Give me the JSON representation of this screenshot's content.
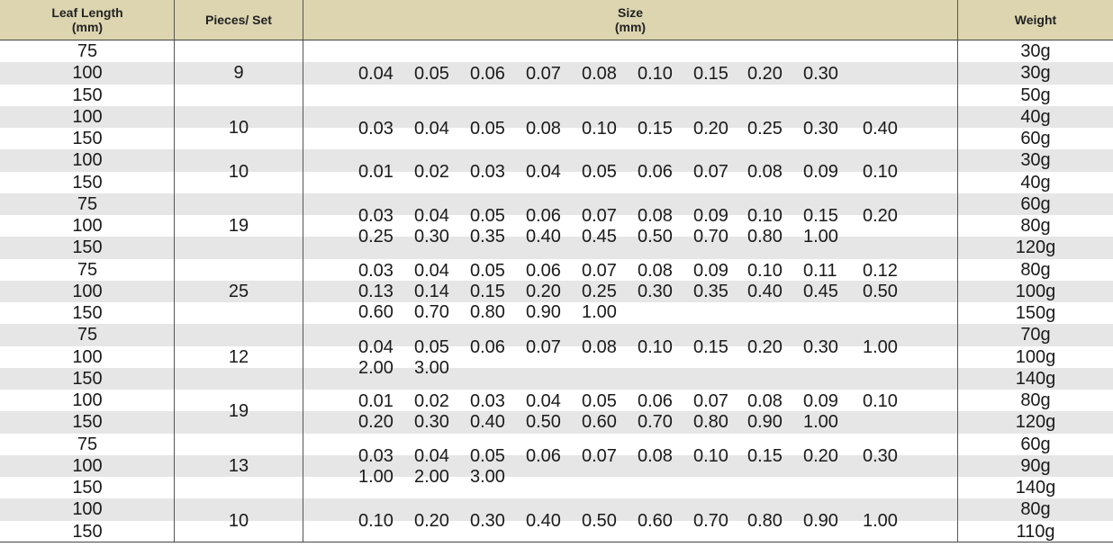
{
  "headers": {
    "leaf_length": [
      "Leaf Length",
      "(mm)"
    ],
    "pieces": "Pieces/ Set",
    "size": [
      "Size",
      "(mm)"
    ],
    "weight": "Weight"
  },
  "groups": [
    {
      "lengths": [
        "75",
        "100",
        "150"
      ],
      "pieces": "9",
      "sizes": [
        [
          "0.04",
          "0.05",
          "0.06",
          "0.07",
          "0.08",
          "0.10",
          "0.15",
          "0.20",
          "0.30"
        ]
      ],
      "weights": [
        "30g",
        "30g",
        "50g"
      ]
    },
    {
      "lengths": [
        "100",
        "150"
      ],
      "pieces": "10",
      "sizes": [
        [
          "0.03",
          "0.04",
          "0.05",
          "0.08",
          "0.10",
          "0.15",
          "0.20",
          "0.25",
          "0.30",
          "0.40"
        ]
      ],
      "weights": [
        "40g",
        "60g"
      ]
    },
    {
      "lengths": [
        "100",
        "150"
      ],
      "pieces": "10",
      "sizes": [
        [
          "0.01",
          "0.02",
          "0.03",
          "0.04",
          "0.05",
          "0.06",
          "0.07",
          "0.08",
          "0.09",
          "0.10"
        ]
      ],
      "weights": [
        "30g",
        "40g"
      ]
    },
    {
      "lengths": [
        "75",
        "100",
        "150"
      ],
      "pieces": "19",
      "sizes": [
        [
          "0.03",
          "0.04",
          "0.05",
          "0.06",
          "0.07",
          "0.08",
          "0.09",
          "0.10",
          "0.15",
          "0.20"
        ],
        [
          "0.25",
          "0.30",
          "0.35",
          "0.40",
          "0.45",
          "0.50",
          "0.70",
          "0.80",
          "1.00"
        ]
      ],
      "weights": [
        "60g",
        "80g",
        "120g"
      ]
    },
    {
      "lengths": [
        "75",
        "100",
        "150"
      ],
      "pieces": "25",
      "sizes": [
        [
          "0.03",
          "0.04",
          "0.05",
          "0.06",
          "0.07",
          "0.08",
          "0.09",
          "0.10",
          "0.11",
          "0.12"
        ],
        [
          "0.13",
          "0.14",
          "0.15",
          "0.20",
          "0.25",
          "0.30",
          "0.35",
          "0.40",
          "0.45",
          "0.50"
        ],
        [
          "0.60",
          "0.70",
          "0.80",
          "0.90",
          "1.00"
        ]
      ],
      "weights": [
        "80g",
        "100g",
        "150g"
      ]
    },
    {
      "lengths": [
        "75",
        "100",
        "150"
      ],
      "pieces": "12",
      "sizes": [
        [
          "0.04",
          "0.05",
          "0.06",
          "0.07",
          "0.08",
          "0.10",
          "0.15",
          "0.20",
          "0.30",
          "1.00"
        ],
        [
          "2.00",
          "3.00"
        ]
      ],
      "weights": [
        "70g",
        "100g",
        "140g"
      ]
    },
    {
      "lengths": [
        "100",
        "150"
      ],
      "pieces": "19",
      "sizes": [
        [
          "0.01",
          "0.02",
          "0.03",
          "0.04",
          "0.05",
          "0.06",
          "0.07",
          "0.08",
          "0.09",
          "0.10"
        ],
        [
          "0.20",
          "0.30",
          "0.40",
          "0.50",
          "0.60",
          "0.70",
          "0.80",
          "0.90",
          "1.00"
        ]
      ],
      "weights": [
        "80g",
        "120g"
      ]
    },
    {
      "lengths": [
        "75",
        "100",
        "150"
      ],
      "pieces": "13",
      "sizes": [
        [
          "0.03",
          "0.04",
          "0.05",
          "0.06",
          "0.07",
          "0.08",
          "0.10",
          "0.15",
          "0.20",
          "0.30"
        ],
        [
          "1.00",
          "2.00",
          "3.00"
        ]
      ],
      "weights": [
        "60g",
        "90g",
        "140g"
      ]
    },
    {
      "lengths": [
        "100",
        "150"
      ],
      "pieces": "10",
      "sizes": [
        [
          "0.10",
          "0.20",
          "0.30",
          "0.40",
          "0.50",
          "0.60",
          "0.70",
          "0.80",
          "0.90",
          "1.00"
        ]
      ],
      "weights": [
        "80g",
        "110g"
      ]
    }
  ]
}
